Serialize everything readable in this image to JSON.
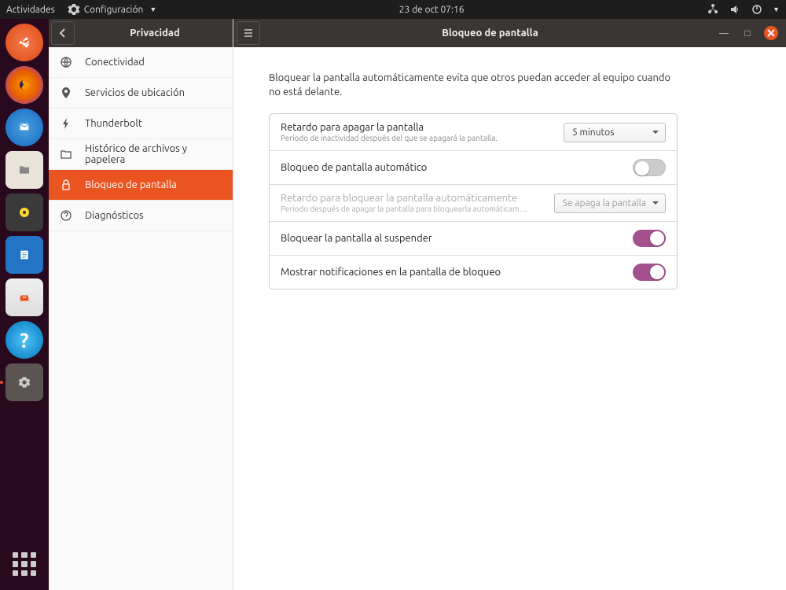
{
  "topbar": {
    "activities": "Actividades",
    "app_menu": "Configuración",
    "datetime": "23 de oct  07:16"
  },
  "window": {
    "sidebar_title": "Privacidad",
    "main_title": "Bloqueo de pantalla"
  },
  "nav": {
    "connectivity": "Conectividad",
    "location": "Servicios de ubicación",
    "thunderbolt": "Thunderbolt",
    "history": "Histórico de archivos y papelera",
    "screenlock": "Bloqueo de pantalla",
    "diagnostics": "Diagnósticos"
  },
  "content": {
    "description": "Bloquear la pantalla automáticamente evita que otros puedan acceder al equipo cuando no está delante.",
    "row1": {
      "label": "Retardo para apagar la pantalla",
      "sub": "Periodo de inactividad después del que se apagará la pantalla.",
      "value": "5 minutos"
    },
    "row2": {
      "label": "Bloqueo de pantalla automático"
    },
    "row3": {
      "label": "Retardo para bloquear la pantalla automáticamente",
      "sub": "Periodo después de apagar la pantalla para bloquearla automáticam…",
      "value": "Se apaga la pantalla"
    },
    "row4": {
      "label": "Bloquear la pantalla al suspender"
    },
    "row5": {
      "label": "Mostrar notificaciones en la pantalla de bloqueo"
    }
  }
}
